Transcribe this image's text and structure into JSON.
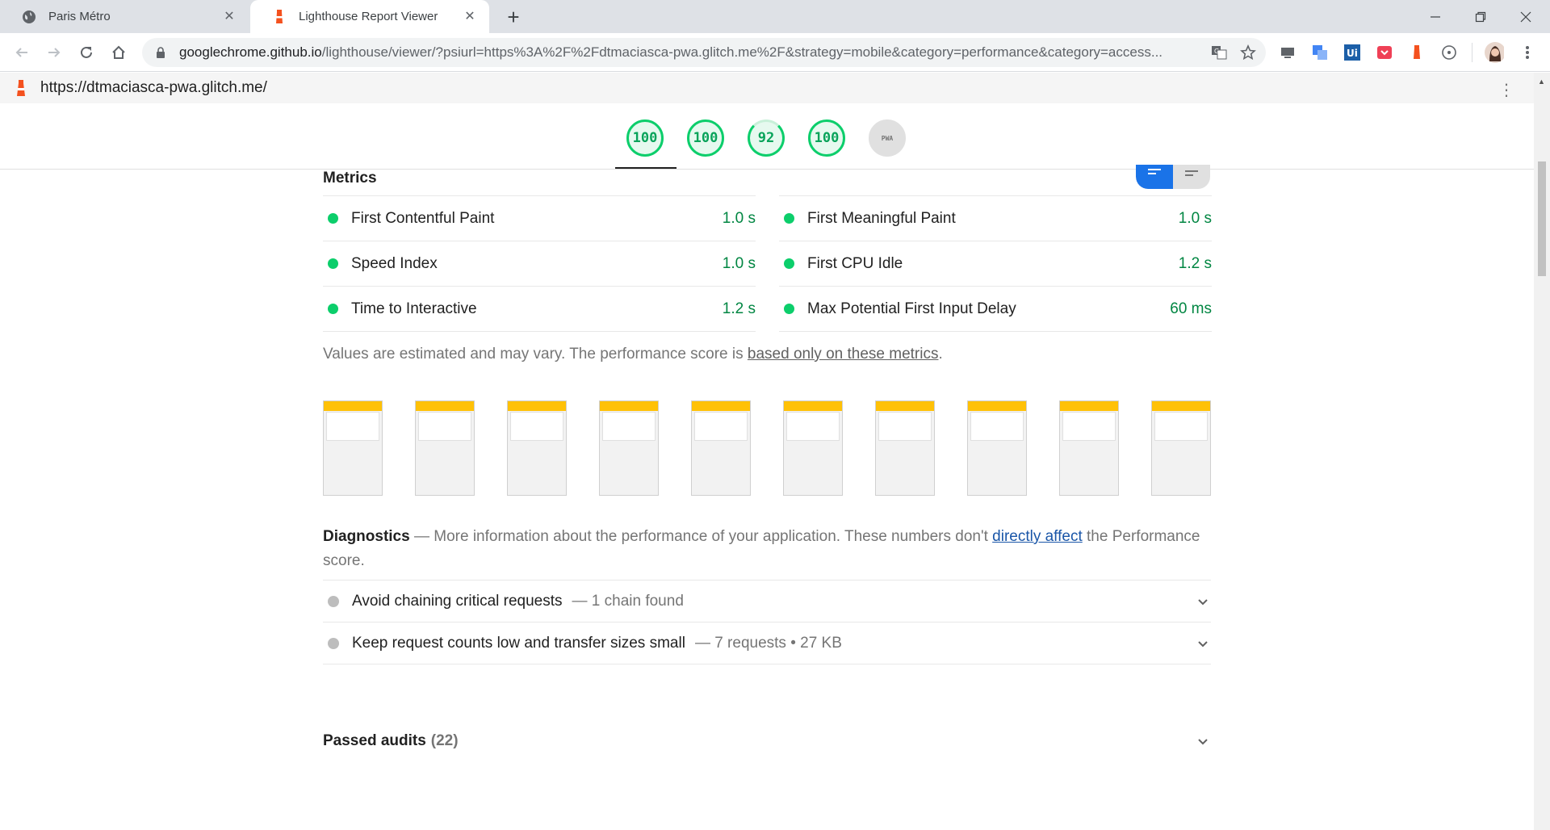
{
  "browser": {
    "tabs": [
      {
        "title": "Paris Métro",
        "active": false
      },
      {
        "title": "Lighthouse Report Viewer",
        "active": true
      }
    ],
    "url_host": "googlechrome.github.io",
    "url_rest": "/lighthouse/viewer/?psiurl=https%3A%2F%2Fdtmaciasca-pwa.glitch.me%2F&strategy=mobile&category=performance&category=access..."
  },
  "report": {
    "page_url": "https://dtmaciasca-pwa.glitch.me/",
    "scores": [
      "100",
      "100",
      "92",
      "100",
      "PWA"
    ],
    "metrics_title": "Metrics",
    "metrics": [
      {
        "label": "First Contentful Paint",
        "value": "1.0 s"
      },
      {
        "label": "First Meaningful Paint",
        "value": "1.0 s"
      },
      {
        "label": "Speed Index",
        "value": "1.0 s"
      },
      {
        "label": "First CPU Idle",
        "value": "1.2 s"
      },
      {
        "label": "Time to Interactive",
        "value": "1.2 s"
      },
      {
        "label": "Max Potential First Input Delay",
        "value": "60 ms"
      }
    ],
    "disclaimer_text": "Values are estimated and may vary. The performance score is ",
    "disclaimer_link": "based only on these metrics",
    "disclaimer_end": ".",
    "diagnostics_title": "Diagnostics",
    "diagnostics_text": " — More information about the performance of your application. These numbers don't ",
    "diagnostics_link": "directly affect",
    "diagnostics_end": " the Performance score.",
    "audits": [
      {
        "title": "Avoid chaining critical requests",
        "detail": "— 1 chain found"
      },
      {
        "title": "Keep request counts low and transfer sizes small",
        "detail": "— 7 requests • 27 KB"
      }
    ],
    "passed_title": "Passed audits",
    "passed_count": "(22)"
  },
  "colors": {
    "pass": "#0cce6b",
    "pass_text": "#018642",
    "link": "#1a56a8",
    "accent": "#1a73e8"
  }
}
